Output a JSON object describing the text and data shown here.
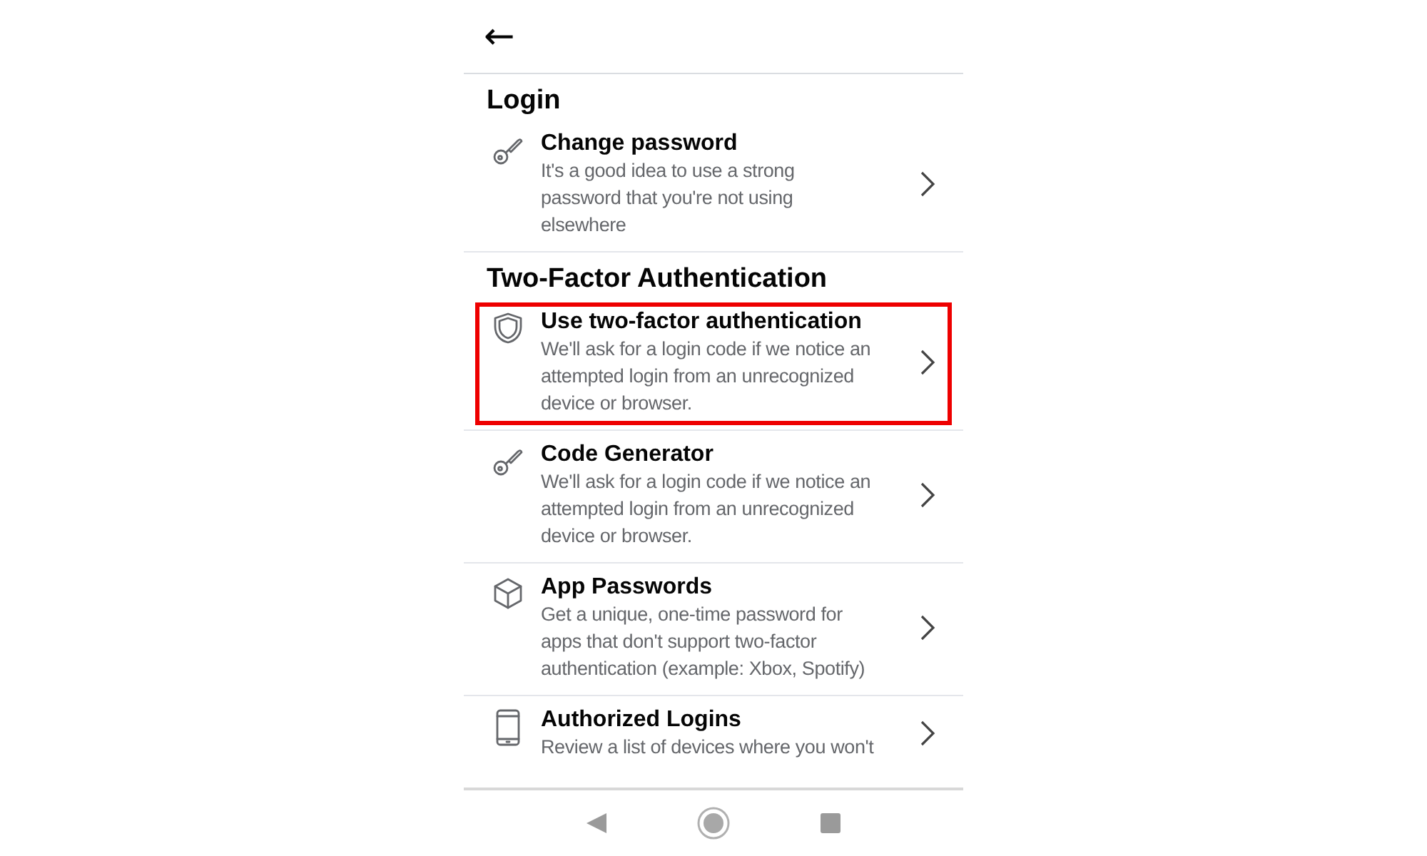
{
  "top_bar": {
    "back": "←"
  },
  "sections": [
    {
      "title": "Login",
      "items": [
        {
          "kind": "key",
          "title": "Change password",
          "description_lines": [
            "It's a good idea to use a strong",
            "password that you're not using",
            "elsewhere"
          ],
          "highlighted": false
        }
      ]
    },
    {
      "title": "Two-Factor Authentication",
      "items": [
        {
          "kind": "shield",
          "title": "Use two-factor authentication",
          "description_lines": [
            "We'll ask for a login code if we notice an",
            "attempted login from an unrecognized",
            "device or browser."
          ],
          "highlighted": true
        },
        {
          "kind": "key",
          "title": "Code Generator",
          "description_lines": [
            "We'll ask for a login code if we notice an",
            "attempted login from an unrecognized",
            "device or browser."
          ],
          "highlighted": false
        },
        {
          "kind": "cube",
          "title": "App Passwords",
          "description_lines": [
            "Get a unique, one-time password for",
            "apps that don't support two-factor",
            "authentication (example: Xbox, Spotify)"
          ],
          "highlighted": false
        },
        {
          "kind": "phone",
          "title": "Authorized Logins",
          "description_lines": [
            "Review a list of devices where you won't"
          ],
          "highlighted": false
        }
      ]
    }
  ]
}
